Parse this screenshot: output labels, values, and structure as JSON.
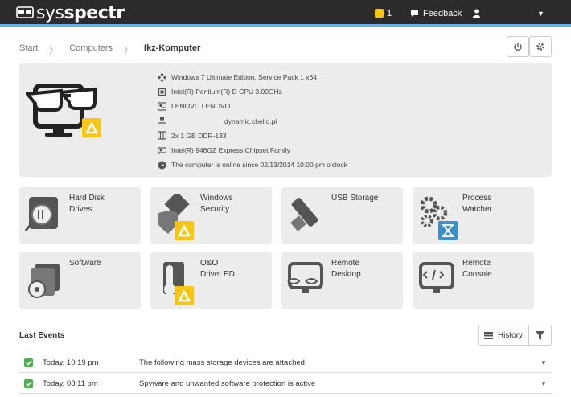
{
  "app": {
    "logo_prefix": "sys",
    "logo_bold": "spectr"
  },
  "topbar": {
    "notifications_count": "1",
    "feedback_label": "Feedback",
    "user_name": "",
    "dropdown_glyph": "▼"
  },
  "breadcrumb": {
    "start": "Start",
    "computers": "Computers",
    "current": "Ikz-Komputer",
    "separator": "〉"
  },
  "computer": {
    "os": "Windows 7 Ultimate Edition, Service Pack 1 x64",
    "cpu": "Intel(R) Pentium(R) D CPU 3.00GHz",
    "manufacturer": "LENOVO LENOVO",
    "host": "dynamic.chello.pl",
    "memory": "2x 1 GB DDR-133",
    "graphics": "Intel(R) 946GZ Express Chipset Family",
    "status": "The computer is online since 02/13/2014 10:00 pm o'clock"
  },
  "tiles": [
    {
      "label": "Hard Disk\nDrives",
      "icon": "hard-disk-icon"
    },
    {
      "label": "Windows\nSecurity",
      "icon": "security-icon",
      "warning": true
    },
    {
      "label": "USB Storage",
      "icon": "usb-icon"
    },
    {
      "label": "Process\nWatcher",
      "icon": "gears-icon",
      "hourglass": true
    },
    {
      "label": "Software",
      "icon": "software-icon"
    },
    {
      "label": "O&O\nDriveLED",
      "icon": "thermometer-icon",
      "warning": true
    },
    {
      "label": "Remote\nDesktop",
      "icon": "remote-desktop-icon"
    },
    {
      "label": "Remote\nConsole",
      "icon": "console-icon"
    }
  ],
  "events": {
    "title": "Last Events",
    "history_label": "History",
    "rows": [
      {
        "time": "Today, 10:19 pm",
        "message": "The following mass storage devices are attached:",
        "caret": "▼"
      },
      {
        "time": "Today, 08:11 pm",
        "message": "Spyware and unwanted software protection is active",
        "caret": "▼"
      }
    ]
  },
  "colors": {
    "topbar": "#2b2b2b",
    "accent": "#6ab0e6",
    "warning": "#f5c518",
    "ok": "#4caf50",
    "panel": "#ececec"
  }
}
